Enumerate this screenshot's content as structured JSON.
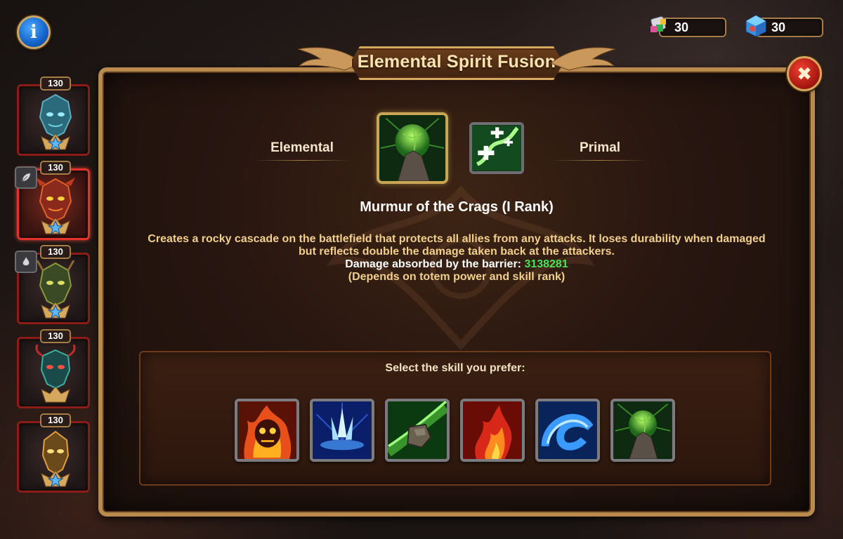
{
  "header": {
    "title": "Elemental Spirit Fusion",
    "info_icon": "info-icon",
    "close_icon": "close-x-icon"
  },
  "currencies": [
    {
      "icon": "tile-gem-icon",
      "value": "30"
    },
    {
      "icon": "crystal-cube-icon",
      "value": "30"
    }
  ],
  "sidebar": {
    "totems": [
      {
        "level": "130",
        "color": "blue",
        "element": ""
      },
      {
        "level": "130",
        "color": "red",
        "element": "leaf-icon",
        "selected": true
      },
      {
        "level": "130",
        "color": "green",
        "element": "fire-icon"
      },
      {
        "level": "130",
        "color": "teal",
        "element": ""
      },
      {
        "level": "130",
        "color": "gold",
        "element": ""
      }
    ]
  },
  "fusion": {
    "left_label": "Elemental",
    "right_label": "Primal",
    "selected_skill_icon": "rock-barrier-icon",
    "secondary_skill_icon": "heal-swirl-icon",
    "skill_name": "Murmur of the Crags (I Rank)",
    "description_1": "Creates a rocky cascade on the battlefield that protects all allies from any attacks. It loses durability when damaged",
    "description_2": "but reflects double the damage taken back at the attackers.",
    "damage_label": "Damage absorbed by the barrier: ",
    "damage_value": "3138281",
    "note": "(Depends on totem power and skill rank)"
  },
  "selection": {
    "prompt": "Select the skill you prefer:",
    "options": [
      {
        "icon": "fire-skull-icon"
      },
      {
        "icon": "ice-crystal-icon"
      },
      {
        "icon": "earth-rock-icon"
      },
      {
        "icon": "fire-flame-icon"
      },
      {
        "icon": "water-wave-icon"
      },
      {
        "icon": "rock-barrier-icon"
      }
    ]
  },
  "colors": {
    "accent_gold": "#d6a85e",
    "desc_text": "#f1cf8d",
    "damage_green": "#48e25a",
    "close_red": "#c8281c"
  }
}
